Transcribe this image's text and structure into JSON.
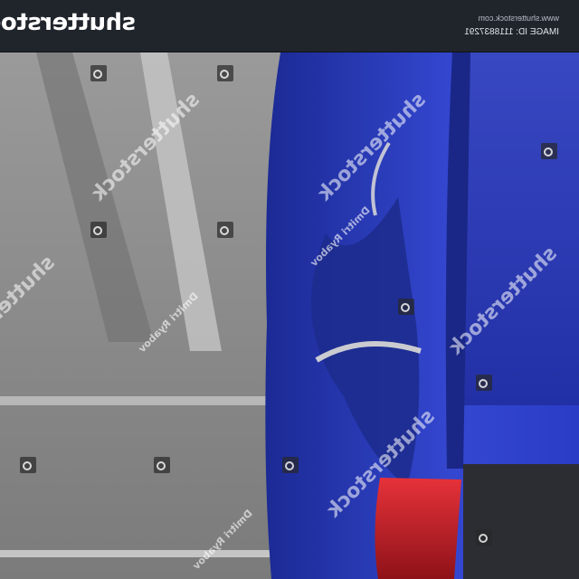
{
  "banner": {
    "brand": "shutterstock",
    "site_url": "www.shutterstock.com",
    "image_id": "IMAGE ID: 1118837291"
  },
  "watermark": {
    "brand": "shutterstock",
    "credit": "Dmitri Ryabov"
  },
  "colors": {
    "banner_bg": "#20242b",
    "car_blue": "#2537b8",
    "asphalt": "#8a8a8a",
    "taillight_red": "#c81e28"
  }
}
